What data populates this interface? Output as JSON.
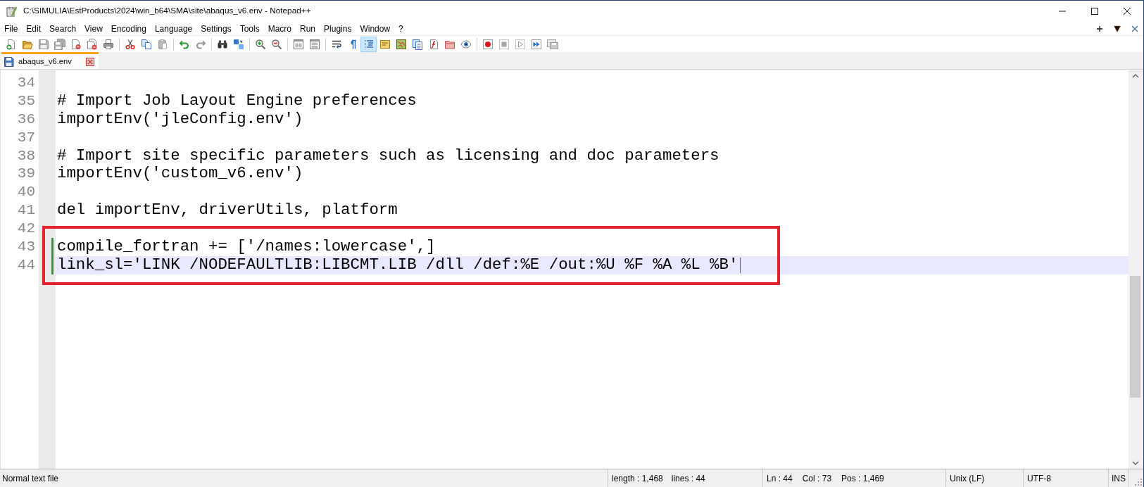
{
  "window": {
    "title": "C:\\SIMULIA\\EstProducts\\2024\\win_b64\\SMA\\site\\abaqus_v6.env - Notepad++"
  },
  "menu_bar": {
    "items": [
      "File",
      "Edit",
      "Search",
      "View",
      "Encoding",
      "Language",
      "Settings",
      "Tools",
      "Macro",
      "Run",
      "Plugins",
      "Window",
      "?"
    ]
  },
  "toolbar": {
    "groups": [
      [
        {
          "kind": "new",
          "pressed": false,
          "disabled": false
        },
        {
          "kind": "open",
          "pressed": false,
          "disabled": false
        },
        {
          "kind": "save",
          "pressed": false,
          "disabled": true
        },
        {
          "kind": "save_all",
          "pressed": false,
          "disabled": true
        },
        {
          "kind": "close",
          "pressed": false,
          "disabled": false
        },
        {
          "kind": "close_all",
          "pressed": false,
          "disabled": false
        },
        {
          "kind": "print",
          "pressed": false,
          "disabled": false
        }
      ],
      [
        {
          "kind": "cut",
          "pressed": false,
          "disabled": false
        },
        {
          "kind": "copy",
          "pressed": false,
          "disabled": false
        },
        {
          "kind": "paste",
          "pressed": false,
          "disabled": true
        }
      ],
      [
        {
          "kind": "undo",
          "pressed": false,
          "disabled": false
        },
        {
          "kind": "redo",
          "pressed": false,
          "disabled": true
        }
      ],
      [
        {
          "kind": "find",
          "pressed": false,
          "disabled": false
        },
        {
          "kind": "replace",
          "pressed": false,
          "disabled": false
        }
      ],
      [
        {
          "kind": "zoom_in",
          "pressed": false,
          "disabled": false
        },
        {
          "kind": "zoom_out",
          "pressed": false,
          "disabled": false
        }
      ],
      [
        {
          "kind": "sync_v",
          "pressed": false,
          "disabled": false
        },
        {
          "kind": "sync_h",
          "pressed": false,
          "disabled": false
        }
      ],
      [
        {
          "kind": "wrap",
          "pressed": false,
          "disabled": false
        },
        {
          "kind": "all_chars",
          "pressed": false,
          "disabled": false
        },
        {
          "kind": "indent_guide",
          "pressed": true,
          "disabled": false
        },
        {
          "kind": "udl",
          "pressed": false,
          "disabled": false
        },
        {
          "kind": "doc_map",
          "pressed": false,
          "disabled": false
        },
        {
          "kind": "doc_list",
          "pressed": false,
          "disabled": false
        },
        {
          "kind": "func_list",
          "pressed": false,
          "disabled": false
        },
        {
          "kind": "folder_ws",
          "pressed": false,
          "disabled": false
        },
        {
          "kind": "monitor",
          "pressed": false,
          "disabled": false
        }
      ],
      [
        {
          "kind": "rec",
          "pressed": false,
          "disabled": false
        },
        {
          "kind": "stop",
          "pressed": false,
          "disabled": true
        },
        {
          "kind": "play",
          "pressed": false,
          "disabled": true
        },
        {
          "kind": "play_multi",
          "pressed": false,
          "disabled": false
        },
        {
          "kind": "save_macro",
          "pressed": false,
          "disabled": true
        }
      ]
    ]
  },
  "tabs": [
    {
      "label": "abaqus_v6.env",
      "selected": true,
      "modified": false
    }
  ],
  "editor": {
    "lines": [
      {
        "number": "34",
        "changed": false,
        "current": false,
        "boxed": false
      },
      {
        "number": "35",
        "text": "# Import Job Layout Engine preferences",
        "changed": false,
        "current": false,
        "boxed": false
      },
      {
        "number": "36",
        "text": "importEnv('jleConfig.env')",
        "changed": false,
        "current": false,
        "boxed": false
      },
      {
        "number": "37",
        "changed": false,
        "current": false,
        "boxed": false
      },
      {
        "number": "38",
        "text": "# Import site specific parameters such as licensing and doc parameters",
        "changed": false,
        "current": false,
        "boxed": false
      },
      {
        "number": "39",
        "text": "importEnv('custom_v6.env')",
        "changed": false,
        "current": false,
        "boxed": false
      },
      {
        "number": "40",
        "changed": false,
        "current": false,
        "boxed": false
      },
      {
        "number": "41",
        "text": "del importEnv, driverUtils, platform",
        "changed": false,
        "current": false,
        "boxed": false
      },
      {
        "number": "42",
        "changed": false,
        "current": false,
        "boxed": false
      },
      {
        "number": "43",
        "text": "compile_fortran += ['/names:lowercase',]",
        "changed": true,
        "current": false,
        "boxed": true
      },
      {
        "number": "44",
        "text": "link_sl='LINK /NODEFAULTLIB:LIBCMT.LIB /dll /def:%E /out:%U %F %A %L %B'",
        "changed": true,
        "current": true,
        "boxed": true
      }
    ]
  },
  "status_bar": {
    "sections": [
      {
        "items": [
          "Normal text file"
        ]
      },
      {
        "items": [
          "length : 1,468",
          "lines : 44"
        ]
      },
      {
        "items": [
          "Ln : 44",
          "Col : 73",
          "Pos : 1,469"
        ]
      },
      {
        "items": [
          "Unix (LF)"
        ]
      },
      {
        "items": [
          "UTF-8"
        ]
      },
      {
        "items": [
          "INS"
        ]
      }
    ]
  }
}
